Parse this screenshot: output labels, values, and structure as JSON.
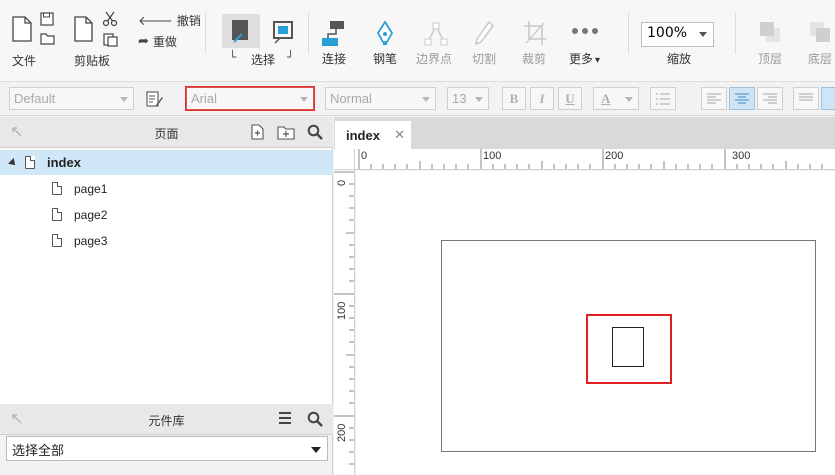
{
  "toolbar": {
    "file_label": "文件",
    "clipboard_label": "剪贴板",
    "undo_label": "撤销",
    "redo_label": "重做",
    "select_label": "选择",
    "connect_label": "连接",
    "pen_label": "钢笔",
    "boundary_label": "边界点",
    "cut_label": "切割",
    "crop_label": "裁剪",
    "more_label": "更多",
    "more_caret": "▾",
    "zoom_value": "100%",
    "zoom_label": "缩放",
    "top_label": "顶层",
    "bottom_label": "底层"
  },
  "format_bar": {
    "style_value": "Default",
    "font_value": "Arial",
    "weight_value": "Normal",
    "size_value": "13",
    "bold": "B",
    "italic": "I",
    "underline": "U",
    "text_color": "A"
  },
  "pages_panel": {
    "title": "页面",
    "pages": [
      {
        "label": "index",
        "selected": true
      },
      {
        "label": "page1"
      },
      {
        "label": "page2"
      },
      {
        "label": "page3"
      }
    ]
  },
  "library_panel": {
    "title": "元件库",
    "select_value": "选择全部"
  },
  "canvas": {
    "tab_label": "index",
    "tab_close": "✕",
    "ruler_h_labels": [
      "0",
      "100",
      "200",
      "300"
    ],
    "ruler_v_labels": [
      "0",
      "100",
      "200"
    ]
  },
  "colors": {
    "accent_blue": "#2a9fd6",
    "selection_red": "#e02020",
    "selected_row": "#cfe7f6"
  }
}
